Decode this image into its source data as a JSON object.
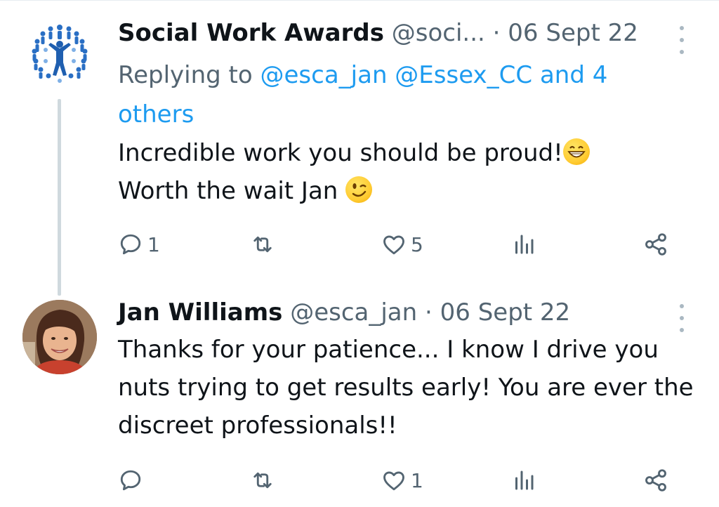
{
  "tweets": [
    {
      "author_name": "Social Work Awards",
      "handle": "@soci...",
      "separator": "·",
      "date": "06 Sept 22",
      "reply_prefix": "Replying to",
      "reply_mentions": "@esca_jan @Essex_CC and 4 others",
      "text_line1": "Incredible work you should be proud!",
      "text_line2": "Worth the wait Jan",
      "emoji1": "beaming-grin",
      "emoji2": "winking-face",
      "counts": {
        "reply": "1",
        "retweet": "",
        "like": "5"
      }
    },
    {
      "author_name": "Jan Williams",
      "handle": "@esca_jan",
      "separator": "·",
      "date": "06 Sept 22",
      "text": "Thanks for your patience... I know I drive you nuts trying to get results early! You are ever the discreet professionals!!",
      "counts": {
        "reply": "",
        "retweet": "",
        "like": "1"
      }
    }
  ],
  "colors": {
    "text": "#0f1419",
    "muted": "#536471",
    "link": "#1d9bf0",
    "thread_line": "#cfd9de",
    "avatar_blue": "#2a6fc4"
  }
}
